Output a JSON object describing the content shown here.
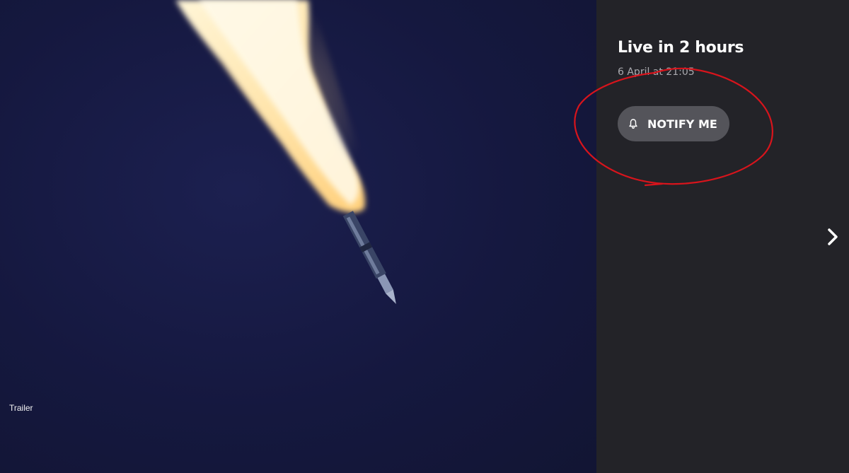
{
  "video": {
    "label": "Trailer"
  },
  "schedule": {
    "title": "Live in 2 hours",
    "date": "6 April at 21:05"
  },
  "notify_button": {
    "label": "NOTIFY ME",
    "icon": "bell-icon"
  },
  "navigation": {
    "next_icon": "chevron-right-icon"
  },
  "colors": {
    "background_video": "#161a42",
    "panel": "#232328",
    "button": "#54545a",
    "annotation": "#d8141c"
  }
}
